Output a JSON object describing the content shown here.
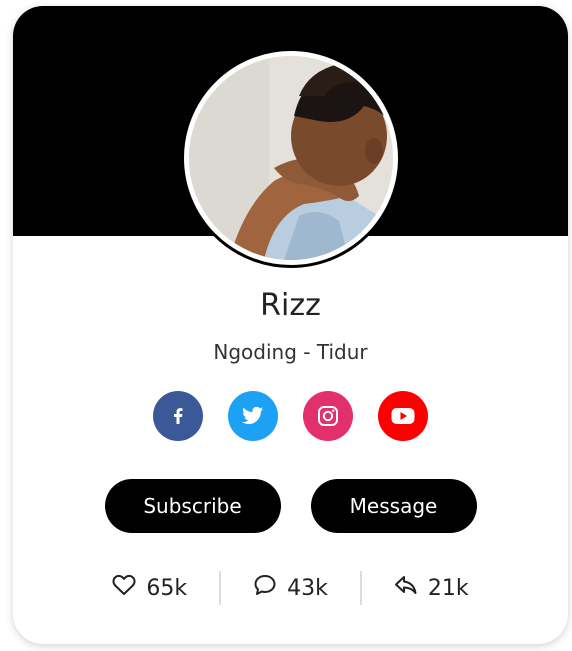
{
  "profile": {
    "name": "Rizz",
    "role": "Ngoding - Tidur"
  },
  "socials": [
    {
      "icon": "facebook-icon",
      "color": "#3b5998"
    },
    {
      "icon": "twitter-icon",
      "color": "#1da1f2"
    },
    {
      "icon": "instagram-icon",
      "color": "#e1306c"
    },
    {
      "icon": "youtube-icon",
      "color": "#ff0000"
    }
  ],
  "buttons": {
    "subscribe": "Subscribe",
    "message": "Message"
  },
  "stats": {
    "likes": "65k",
    "comments": "43k",
    "shares": "21k"
  },
  "colors": {
    "banner": "#000000",
    "button": "#000000",
    "text": "#222222"
  }
}
